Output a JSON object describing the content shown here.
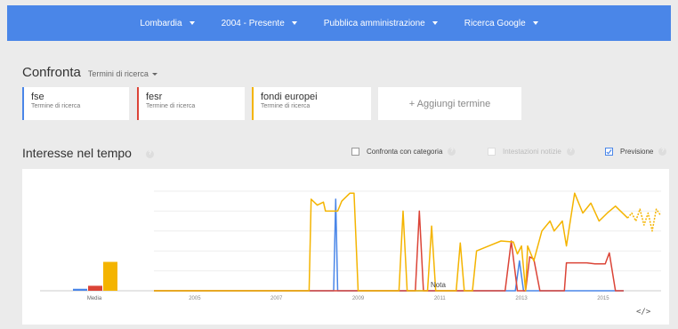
{
  "filters": [
    {
      "label": "Lombardia"
    },
    {
      "label": "2004 - Presente"
    },
    {
      "label": "Pubblica amministrazione"
    },
    {
      "label": "Ricerca Google"
    }
  ],
  "compare": {
    "title": "Confronta",
    "subtitle": "Termini di ricerca"
  },
  "terms": [
    {
      "name": "fse",
      "type": "Termine di ricerca",
      "color": "#4a86e8"
    },
    {
      "name": "fesr",
      "type": "Termine di ricerca",
      "color": "#db4437"
    },
    {
      "name": "fondi europei",
      "type": "Termine di ricerca",
      "color": "#f4b400"
    }
  ],
  "add_term": "+ Aggiungi termine",
  "section": {
    "title": "Interesse nel tempo"
  },
  "options": {
    "compare_category": "Confronta con categoria",
    "headlines": "Intestazioni notizie",
    "forecast": "Previsione"
  },
  "help_glyph": "?",
  "embed_icon": "</>",
  "note_label": "Nota",
  "chart_data": {
    "type": "line",
    "x_labels": [
      "2005",
      "2007",
      "2009",
      "2011",
      "2013",
      "2015"
    ],
    "ylim": [
      0,
      100
    ],
    "average": {
      "label": "Media",
      "values": [
        {
          "series": "fse",
          "value": 2
        },
        {
          "series": "fesr",
          "value": 5
        },
        {
          "series": "fondi europei",
          "value": 29
        }
      ]
    },
    "series": [
      {
        "name": "fse",
        "color": "#4a86e8",
        "points": [
          [
            2004,
            0
          ],
          [
            2008.4,
            0
          ],
          [
            2008.45,
            92
          ],
          [
            2008.5,
            0
          ],
          [
            2012.0,
            0
          ],
          [
            2012.85,
            0
          ],
          [
            2012.95,
            30
          ],
          [
            2013.05,
            0
          ],
          [
            2015.5,
            0
          ]
        ]
      },
      {
        "name": "fesr",
        "color": "#db4437",
        "points": [
          [
            2004,
            0
          ],
          [
            2010.4,
            0
          ],
          [
            2010.5,
            80
          ],
          [
            2010.6,
            0
          ],
          [
            2012.6,
            0
          ],
          [
            2012.75,
            50
          ],
          [
            2012.9,
            0
          ],
          [
            2013.1,
            0
          ],
          [
            2013.2,
            34
          ],
          [
            2013.3,
            32
          ],
          [
            2013.45,
            0
          ],
          [
            2014.05,
            0
          ],
          [
            2014.1,
            28
          ],
          [
            2014.6,
            28
          ],
          [
            2014.8,
            27
          ],
          [
            2015.05,
            27
          ],
          [
            2015.15,
            38
          ],
          [
            2015.3,
            0
          ],
          [
            2015.5,
            0
          ]
        ]
      },
      {
        "name": "fondi europei",
        "color": "#f4b400",
        "points": [
          [
            2004,
            0
          ],
          [
            2007.8,
            0
          ],
          [
            2007.85,
            92
          ],
          [
            2008.0,
            86
          ],
          [
            2008.15,
            89
          ],
          [
            2008.2,
            80
          ],
          [
            2008.5,
            80
          ],
          [
            2008.6,
            90
          ],
          [
            2008.8,
            98
          ],
          [
            2008.9,
            98
          ],
          [
            2009.0,
            0
          ],
          [
            2010.0,
            0
          ],
          [
            2010.1,
            80
          ],
          [
            2010.2,
            0
          ],
          [
            2010.7,
            0
          ],
          [
            2010.8,
            65
          ],
          [
            2010.9,
            0
          ],
          [
            2011.4,
            0
          ],
          [
            2011.5,
            48
          ],
          [
            2011.6,
            0
          ],
          [
            2011.8,
            0
          ],
          [
            2011.9,
            40
          ],
          [
            2012.2,
            45
          ],
          [
            2012.5,
            50
          ],
          [
            2012.8,
            49
          ],
          [
            2012.9,
            37
          ],
          [
            2013.0,
            45
          ],
          [
            2013.1,
            0
          ],
          [
            2013.15,
            45
          ],
          [
            2013.3,
            30
          ],
          [
            2013.5,
            60
          ],
          [
            2013.7,
            70
          ],
          [
            2013.8,
            60
          ],
          [
            2014.0,
            70
          ],
          [
            2014.1,
            45
          ],
          [
            2014.3,
            98
          ],
          [
            2014.5,
            78
          ],
          [
            2014.7,
            88
          ],
          [
            2014.9,
            70
          ],
          [
            2015.1,
            78
          ],
          [
            2015.3,
            85
          ],
          [
            2015.6,
            73
          ]
        ]
      },
      {
        "name": "fondi europei (previsione)",
        "color": "#f4b400",
        "dashed": true,
        "points": [
          [
            2015.6,
            73
          ],
          [
            2015.7,
            78
          ],
          [
            2015.8,
            70
          ],
          [
            2015.9,
            82
          ],
          [
            2016.0,
            66
          ],
          [
            2016.1,
            78
          ],
          [
            2016.2,
            60
          ],
          [
            2016.3,
            82
          ],
          [
            2016.4,
            76
          ]
        ]
      }
    ]
  }
}
